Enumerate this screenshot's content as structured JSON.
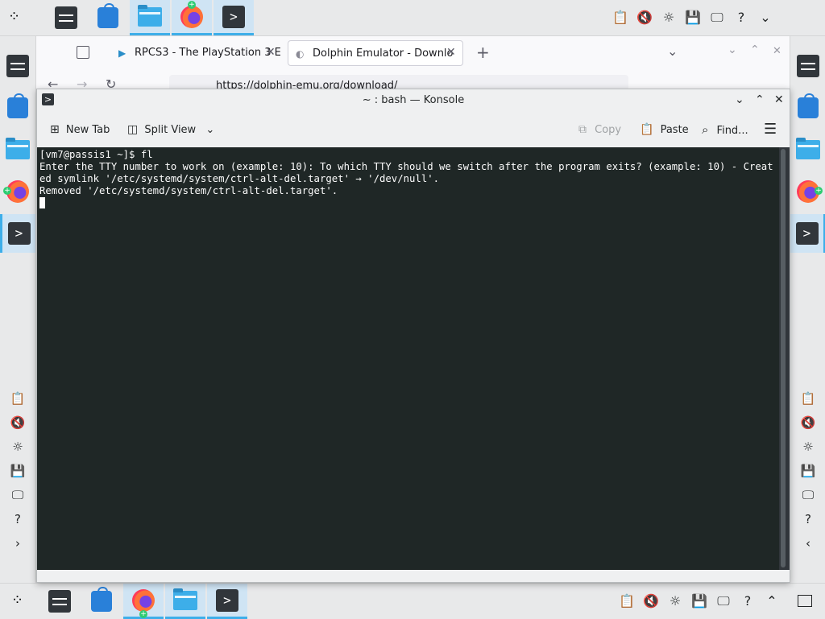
{
  "taskbar": {
    "launchers": [
      "system-settings",
      "discover",
      "dolphin",
      "firefox",
      "konsole"
    ],
    "tray": [
      "clipboard",
      "volume-muted",
      "brightness",
      "save",
      "display",
      "help"
    ]
  },
  "browser": {
    "tabs": [
      {
        "label": "RPCS3 - The PlayStation 3 E"
      },
      {
        "label": "Dolphin Emulator - Downlo"
      }
    ],
    "url": "https://dolphin-emu.org/download/"
  },
  "konsole": {
    "title": "~ : bash — Konsole",
    "toolbar": {
      "new_tab": "New Tab",
      "split_view": "Split View",
      "copy": "Copy",
      "paste": "Paste",
      "find": "Find..."
    },
    "lines": [
      "[vm7@passis1 ~]$ fl",
      "Enter the TTY number to work on (example: 10): To which TTY should we switch after the program exits? (example: 10) - Created symlink '/etc/systemd/system/ctrl-alt-del.target' → '/dev/null'.",
      "Removed '/etc/systemd/system/ctrl-alt-del.target'."
    ]
  }
}
